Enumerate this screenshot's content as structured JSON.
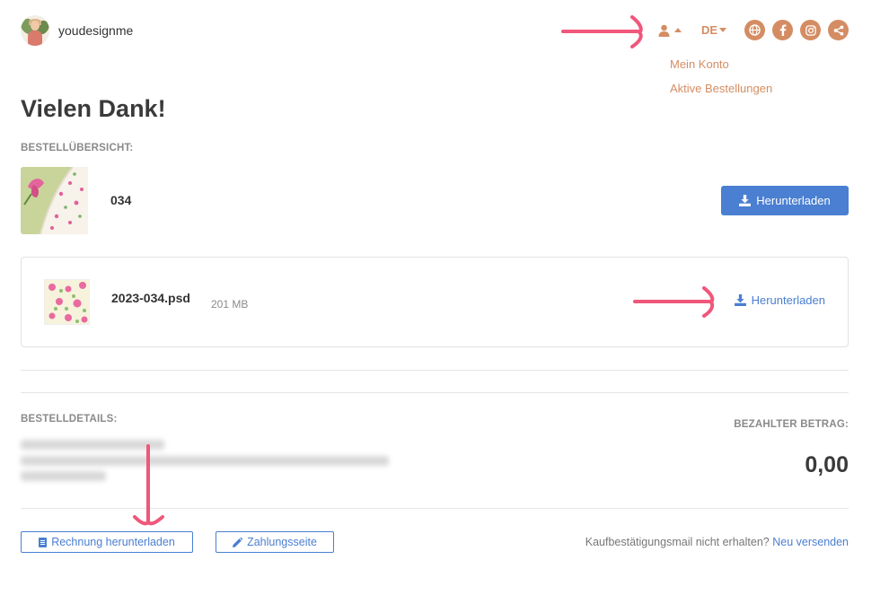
{
  "header": {
    "brand_name": "youdesignme",
    "language": "DE",
    "social_icons": [
      "globe-icon",
      "facebook-icon",
      "instagram-icon",
      "share-icon"
    ]
  },
  "user_dropdown": {
    "items": [
      "Mein Konto",
      "Aktive Bestellungen"
    ]
  },
  "main": {
    "title": "Vielen Dank!",
    "overview_label": "BESTELLÜBERSICHT:",
    "product": {
      "name": "034",
      "download_label": "Herunterladen"
    },
    "file": {
      "name": "2023-034.psd",
      "size": "201 MB",
      "download_label": "Herunterladen"
    },
    "details_label": "BESTELLDETAILS:",
    "paid_label": "BEZAHLTER BETRAG:",
    "paid_amount": "0,00"
  },
  "footer": {
    "invoice_button": "Rechnung herunterladen",
    "payment_page_button": "Zahlungsseite",
    "mail_question": "Kaufbestätigungsmail nicht erhalten?",
    "resend_link": "Neu versenden"
  },
  "colors": {
    "accent": "#d48d63",
    "primary": "#4a7fd1",
    "annotation": "#f0577a"
  }
}
